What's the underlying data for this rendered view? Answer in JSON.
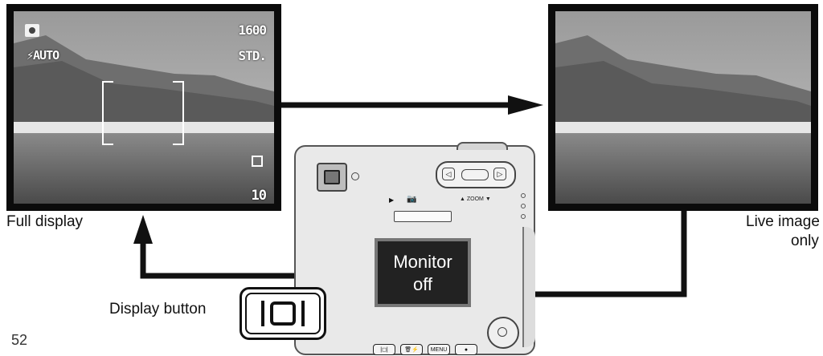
{
  "osd": {
    "flash_label": "⚡AUTO",
    "iso_label": "1600",
    "quality_label": "STD.",
    "frames_remaining": "10"
  },
  "labels": {
    "full_display": "Full display",
    "live_image_line1": "Live image",
    "live_image_line2": "only",
    "monitor_line1": "Monitor",
    "monitor_line2": "off",
    "display_button": "Display button",
    "zoom": "▲ ZOOM ▼",
    "menu_button": "MENU"
  },
  "page_number": "52"
}
